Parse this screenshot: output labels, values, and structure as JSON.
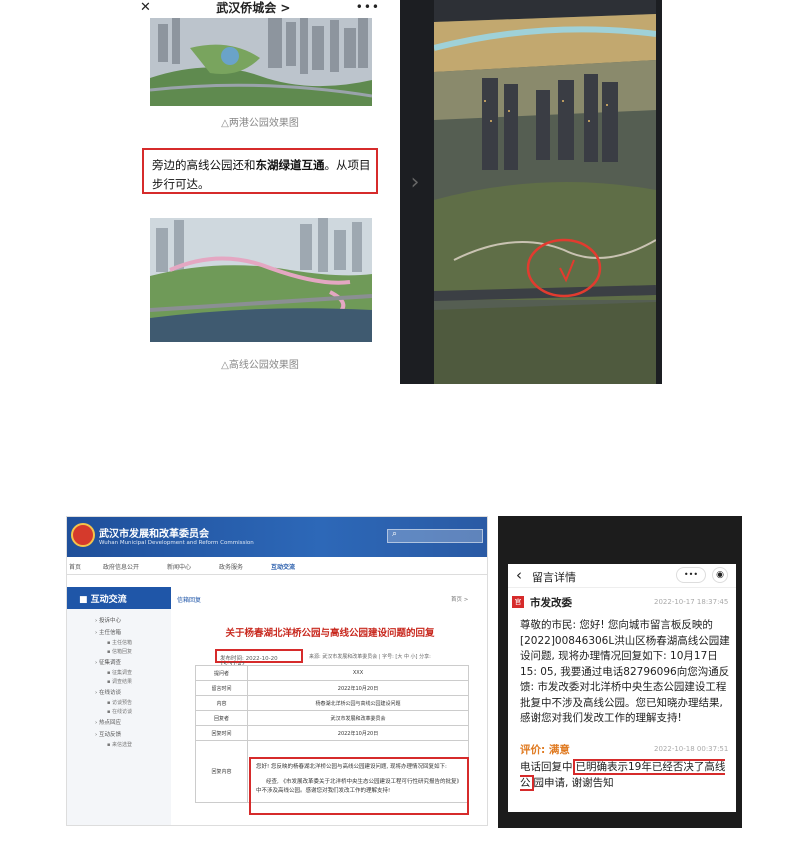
{
  "phone1": {
    "close_icon": "close-icon",
    "title": "武汉侨城会 >",
    "more_icon": "more-icon",
    "caption_top": "△两港公园效果图",
    "highlight_parts": [
      "旁边的高线公园还和",
      "东湖绿道互通",
      "。从项目步行可达。"
    ],
    "caption_bottom": "△高线公园效果图"
  },
  "website": {
    "org_cn": "武汉市发展和改革委员会",
    "org_en": "Wuhan Municipal Development and Reform Commission",
    "nav": [
      "首页",
      "政府信息公开",
      "新闻中心",
      "政务服务",
      "互动交流"
    ],
    "side_title": "互动交流",
    "side_items": [
      {
        "label": "投诉中心",
        "subs": []
      },
      {
        "label": "主任信箱",
        "subs": [
          "主任信箱",
          "信箱回复"
        ]
      },
      {
        "label": "征集调查",
        "subs": [
          "征集调查",
          "调查结果"
        ]
      },
      {
        "label": "在线访谈",
        "subs": [
          "访谈预告",
          "在线访谈"
        ]
      },
      {
        "label": "热点回应",
        "subs": []
      },
      {
        "label": "互动反馈",
        "subs": [
          "来信选登"
        ]
      }
    ],
    "breadcrumb_left": "信箱回复",
    "breadcrumb_right": "首页 >",
    "article_title": "关于杨春湖北洋桥公园与高线公园建设问题的回复",
    "publish_time": "发布时间: 2022-10-20 15:37:42",
    "meta": "来源: 武汉市发展和改革委员会 | 字号: [大 中 小] 分享:",
    "table": {
      "rows": [
        {
          "k": "提问者",
          "v": "XXX"
        },
        {
          "k": "留言时间",
          "v": "2022年10月20日"
        },
        {
          "k": "内容",
          "v": "杨春湖北洋桥公园与高线公园建设问题"
        },
        {
          "k": "回复者",
          "v": "武汉市发展和改革委员会"
        },
        {
          "k": "回复时间",
          "v": "2022年10月20日"
        }
      ],
      "reply_key": "回复内容",
      "reply_p1": "您好! 您反映的杨春湖北洋桥公园与高线公园建设问题, 现将办理情况回复如下:",
      "reply_p2": "经查, 《市发展改革委关于北洋桥中央生态公园建设工程可行性研究报告的批复》中不涉及高线公园。感谢您对我们发改工作的理解支持!"
    }
  },
  "phone3": {
    "back_icon": "back-icon",
    "title": "留言详情",
    "more_icon": "more-icon",
    "record_icon": "record-icon",
    "sender": "市发改委",
    "sender_badge": "官",
    "sender_time": "2022-10-17 18:37:45",
    "body": "尊敬的市民: 您好! 您向城市留言板反映的[2022]00846306L洪山区杨春湖高线公园建设问题, 现将办理情况回复如下: 10月17日15: 05, 我要通过电话82796096向您沟通反馈: 市发改委对北洋桥中央生态公园建设工程批复中不涉及高线公园。您已知晓办理结果, 感谢您对我们发改工作的理解支持!",
    "eval_label": "评价: 满意",
    "eval_time": "2022-10-18 00:37:51",
    "reply_before": "电话回复中",
    "reply_highlight": "已明确表示19年已经否决了高线公",
    "reply_after": "园申请, 谢谢告知"
  },
  "colors": {
    "highlight_red": "#d62b2b",
    "banner_blue": "#1f56a8",
    "title_red": "#c8281e"
  }
}
